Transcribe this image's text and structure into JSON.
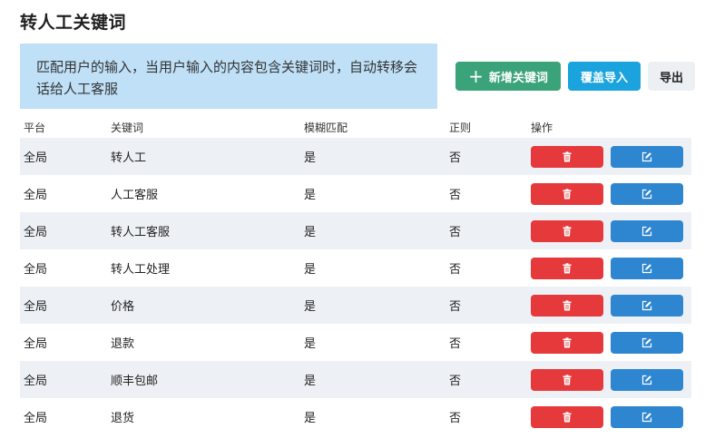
{
  "page": {
    "title": "转人工关键词"
  },
  "info": {
    "text": "匹配用户的输入，当用户输入的内容包含关键词时，自动转移会话给人工客服"
  },
  "toolbar": {
    "add_label": "新增关键词",
    "import_label": "覆盖导入",
    "export_label": "导出"
  },
  "table": {
    "headers": {
      "platform": "平台",
      "keyword": "关键词",
      "fuzzy": "模糊匹配",
      "regex": "正则",
      "ops": "操作"
    },
    "rows": [
      {
        "platform": "全局",
        "keyword": "转人工",
        "fuzzy": "是",
        "regex": "否"
      },
      {
        "platform": "全局",
        "keyword": "人工客服",
        "fuzzy": "是",
        "regex": "否"
      },
      {
        "platform": "全局",
        "keyword": "转人工客服",
        "fuzzy": "是",
        "regex": "否"
      },
      {
        "platform": "全局",
        "keyword": "转人工处理",
        "fuzzy": "是",
        "regex": "否"
      },
      {
        "platform": "全局",
        "keyword": "价格",
        "fuzzy": "是",
        "regex": "否"
      },
      {
        "platform": "全局",
        "keyword": "退款",
        "fuzzy": "是",
        "regex": "否"
      },
      {
        "platform": "全局",
        "keyword": "顺丰包邮",
        "fuzzy": "是",
        "regex": "否"
      },
      {
        "platform": "全局",
        "keyword": "退货",
        "fuzzy": "是",
        "regex": "否"
      }
    ]
  },
  "icons": {
    "delete": "trash-icon",
    "edit": "edit-icon",
    "add": "plus-icon"
  },
  "colors": {
    "delete": "#e5393b",
    "edit": "#2e86d0",
    "add": "#3aa37a",
    "import": "#1aa3dd"
  }
}
